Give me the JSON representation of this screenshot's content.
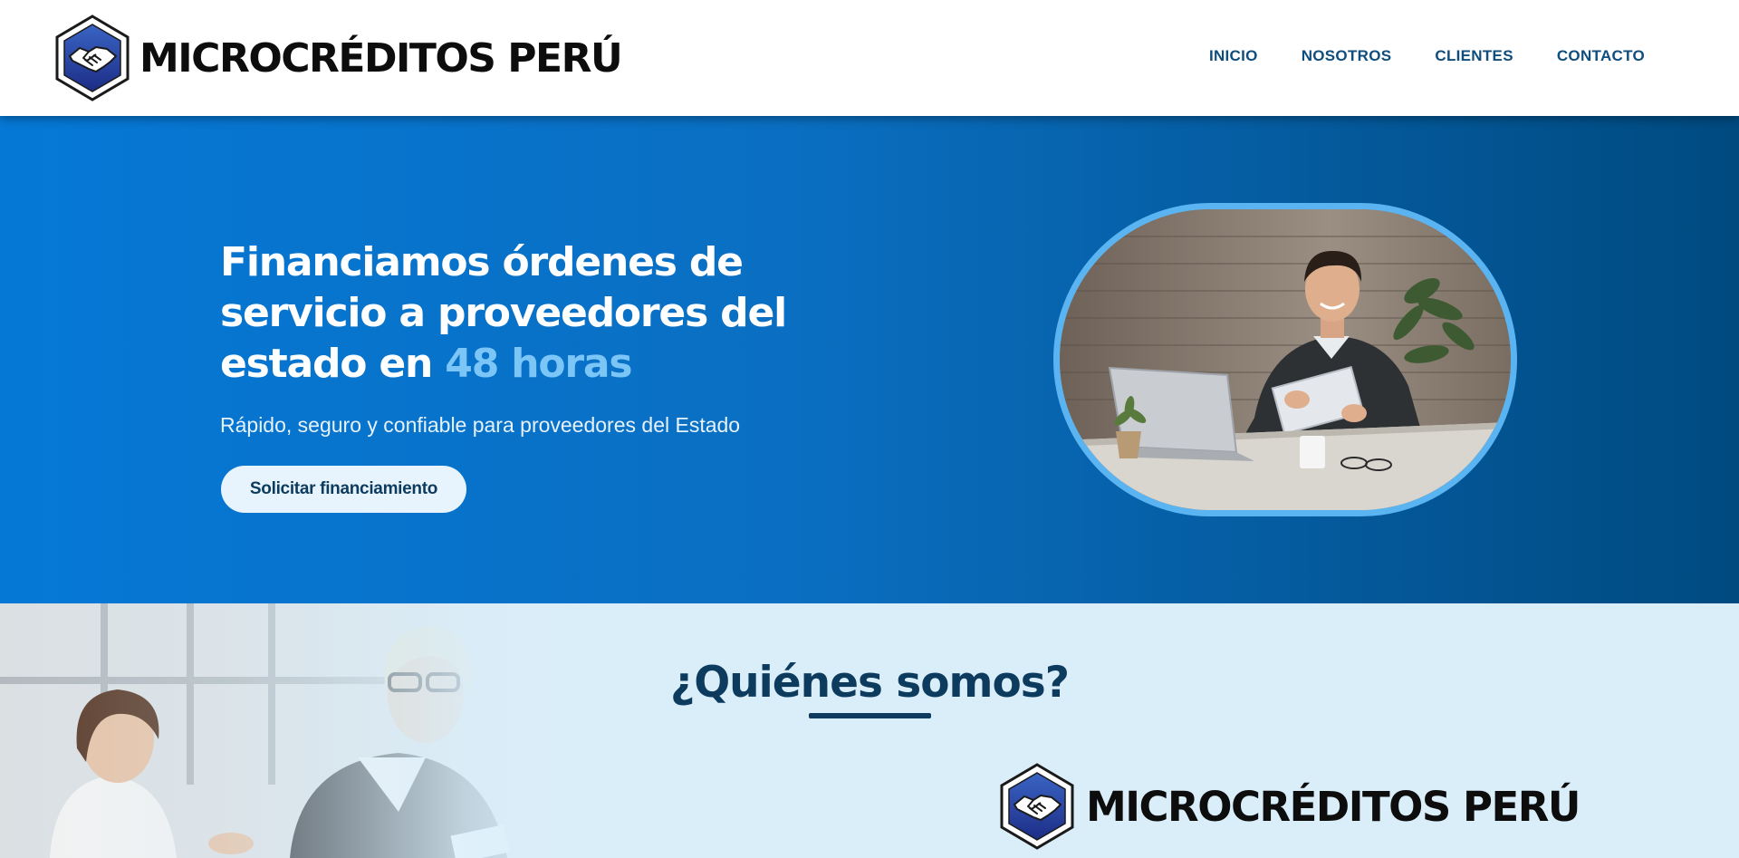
{
  "header": {
    "brand_name": "MICROCRÉDITOS PERÚ",
    "logo_icon": "handshake-icon",
    "nav": [
      {
        "label": "INICIO"
      },
      {
        "label": "NOSOTROS"
      },
      {
        "label": "CLIENTES"
      },
      {
        "label": "CONTACTO"
      }
    ]
  },
  "hero": {
    "title_main": "Financiamos órdenes de servicio a proveedores del estado en ",
    "title_highlight": "48 horas",
    "subtitle": "Rápido, seguro y confiable para proveedores del Estado",
    "cta_label": "Solicitar financiamiento"
  },
  "about": {
    "title": "¿Quiénes somos?",
    "brand_name": "MICROCRÉDITOS PERÚ"
  },
  "colors": {
    "hero_start": "#0578d6",
    "hero_end": "#004a80",
    "highlight": "#7cc6f7",
    "nav_text": "#0f4d7d",
    "about_bg": "#daeefa",
    "heading": "#0d3b5e"
  }
}
